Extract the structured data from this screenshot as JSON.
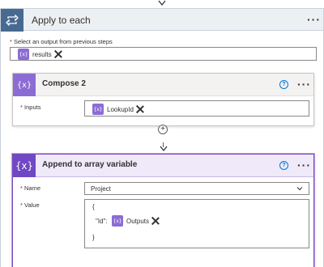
{
  "apply_to_each": {
    "title": "Apply to each",
    "select_label": "Select an output from previous steps",
    "token": {
      "icon": "{x}",
      "label": "results"
    }
  },
  "compose": {
    "title": "Compose 2",
    "icon": "{x}",
    "inputs_label": "Inputs",
    "token": {
      "icon": "{x}",
      "label": "LookupId"
    }
  },
  "append": {
    "title": "Append to array variable",
    "icon": "{x}",
    "name_label": "Name",
    "name_value": "Project",
    "value_label": "Value",
    "value_lines": [
      "{",
      "\"Id\":",
      "}"
    ],
    "token": {
      "icon": "{x}",
      "label": "Outputs"
    }
  },
  "common": {
    "required_mark": "*",
    "help": "?",
    "more": "···"
  },
  "colors": {
    "accent": "#7048c4",
    "token": "#8c6cd4",
    "apply": "#486991",
    "help": "#0078d4"
  }
}
